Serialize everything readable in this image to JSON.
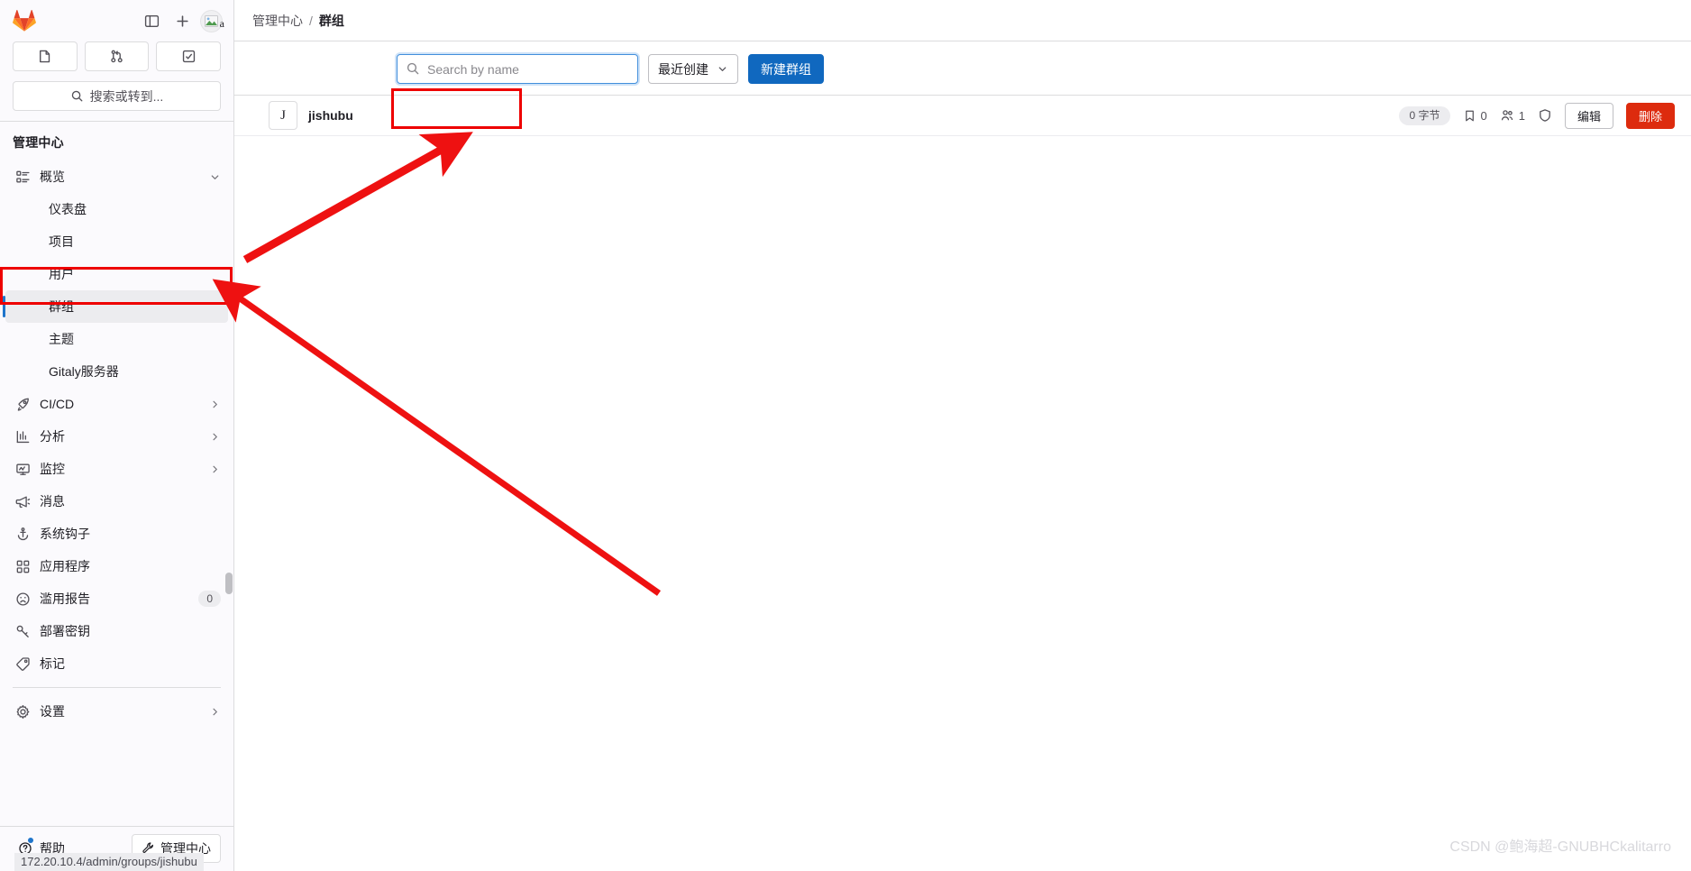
{
  "window": {
    "status_url": "172.20.10.4/admin/groups/jishubu",
    "watermark": "CSDN @鲍海超-GNUBHCkalitarro"
  },
  "sidebar": {
    "logo_name": "gitlab-logo",
    "top_actions": [
      {
        "name": "toggle-sidebar-icon",
        "title": "收起侧边栏"
      },
      {
        "name": "create-new-icon",
        "title": "创建新..."
      }
    ],
    "avatar_letter": "a",
    "quick_actions": [
      {
        "name": "issues-icon",
        "title": "议题"
      },
      {
        "name": "merge-requests-icon",
        "title": "合并请求"
      },
      {
        "name": "todos-icon",
        "title": "待办事项"
      }
    ],
    "search_label": "搜索或转到...",
    "section_title": "管理中心",
    "items": [
      {
        "label": "概览",
        "icon": "overview-icon",
        "type": "parent",
        "chevron": "down",
        "active": false
      },
      {
        "label": "仪表盘",
        "icon": "",
        "type": "sub",
        "chevron": "",
        "active": false
      },
      {
        "label": "项目",
        "icon": "",
        "type": "sub",
        "chevron": "",
        "active": false
      },
      {
        "label": "用户",
        "icon": "",
        "type": "sub",
        "chevron": "",
        "active": false
      },
      {
        "label": "群组",
        "icon": "",
        "type": "sub",
        "chevron": "",
        "active": true
      },
      {
        "label": "主题",
        "icon": "",
        "type": "sub",
        "chevron": "",
        "active": false
      },
      {
        "label": "Gitaly服务器",
        "icon": "",
        "type": "sub",
        "chevron": "",
        "active": false
      },
      {
        "label": "CI/CD",
        "icon": "rocket-icon",
        "type": "parent",
        "chevron": "right",
        "active": false
      },
      {
        "label": "分析",
        "icon": "chart-icon",
        "type": "parent",
        "chevron": "right",
        "active": false
      },
      {
        "label": "监控",
        "icon": "monitor-icon",
        "type": "parent",
        "chevron": "right",
        "active": false
      },
      {
        "label": "消息",
        "icon": "megaphone-icon",
        "type": "leaf",
        "chevron": "",
        "active": false
      },
      {
        "label": "系统钩子",
        "icon": "hook-icon",
        "type": "leaf",
        "chevron": "",
        "active": false
      },
      {
        "label": "应用程序",
        "icon": "applications-icon",
        "type": "leaf",
        "chevron": "",
        "active": false
      },
      {
        "label": "滥用报告",
        "icon": "abuse-icon",
        "type": "leaf",
        "chevron": "",
        "active": false,
        "badge": "0"
      },
      {
        "label": "部署密钥",
        "icon": "key-icon",
        "type": "leaf",
        "chevron": "",
        "active": false
      },
      {
        "label": "标记",
        "icon": "label-icon",
        "type": "leaf",
        "chevron": "",
        "active": false
      },
      {
        "label": "设置",
        "icon": "gear-icon",
        "type": "parent",
        "chevron": "right",
        "active": false,
        "separator_before": true
      }
    ],
    "help_label": "帮助",
    "admin_label": "管理中心"
  },
  "breadcrumb": {
    "root": "管理中心",
    "separator": "/",
    "current": "群组"
  },
  "toolbar": {
    "search_value": "",
    "search_placeholder": "Search by name",
    "sort_label": "最近创建",
    "new_group_label": "新建群组"
  },
  "groups": [
    {
      "avatar_letter": "J",
      "name": "jishubu",
      "size_badge": "0 字节",
      "projects_count": "0",
      "members_count": "1",
      "visibility_icon": "shield-icon",
      "edit_label": "编辑",
      "delete_label": "删除"
    }
  ],
  "colors": {
    "accent_blue": "#1068bf",
    "focus_blue": "#428fdc",
    "danger_red": "#dd2b0e",
    "annotation_red": "#ee0000",
    "sidebar_bg": "#fbfafd",
    "active_bg": "#ececef"
  }
}
